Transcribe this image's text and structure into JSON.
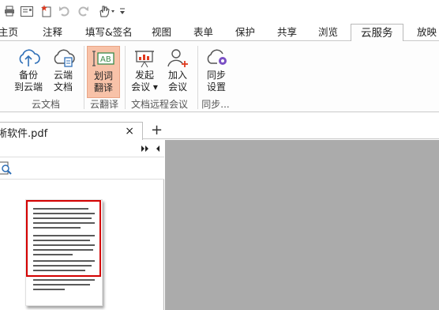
{
  "quick_access": {
    "icons": [
      "print-icon",
      "email-icon",
      "new-document-icon",
      "undo-icon",
      "redo-icon",
      "hand-tool-icon",
      "customize-toolbar-icon"
    ]
  },
  "ribbon_tabs": [
    "主页",
    "注释",
    "填写&签名",
    "视图",
    "表单",
    "保护",
    "共享",
    "浏览",
    "云服务",
    "放映"
  ],
  "active_tab": "云服务",
  "ribbon": {
    "buttons": {
      "backup": "备份\n到云端",
      "cloud_docs": "云端\n文档",
      "word_translate": "划词\n翻译",
      "start_meeting": "发起\n会议 ▾",
      "join_meeting": "加入\n会议",
      "sync_settings": "同步\n设置"
    },
    "groups": {
      "cloud_docs": "云文档",
      "cloud_translate": "云翻译",
      "remote_meeting": "文档远程会议",
      "sync": "同步..."
    }
  },
  "document_tab": {
    "name": "晰软件.pdf",
    "close": "×",
    "add": "+"
  },
  "colors": {
    "selected_button": "#f8c2a8",
    "thumbnail_highlight": "#d40000",
    "workspace": "#ababab"
  }
}
